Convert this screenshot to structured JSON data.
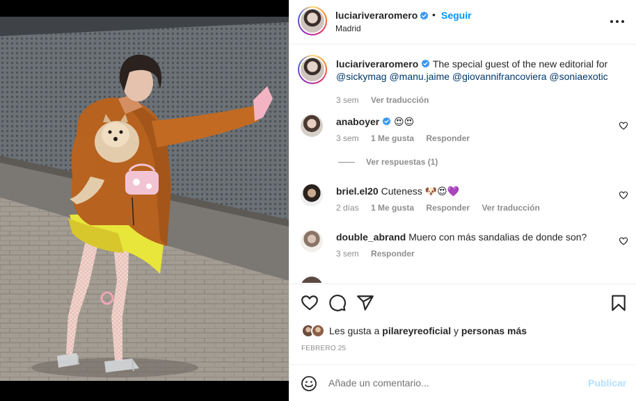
{
  "post": {
    "author": {
      "username": "luciariveraromero",
      "follow_label": "Seguir",
      "location": "Madrid",
      "more_icon": "more-horizontal-icon"
    },
    "caption": {
      "username": "luciariveraromero",
      "text": "The special guest of the new editorial for",
      "mentions": "@sickymag @manu.jaime @giovannifrancoviera @soniaexotic",
      "time": "3 sem",
      "translate_label": "Ver traducción"
    },
    "comments": [
      {
        "username": "anaboyer",
        "verified": true,
        "text": "😍😍",
        "time": "3 sem",
        "likes": "1 Me gusta",
        "reply_label": "Responder",
        "view_replies": "Ver respuestas (1)"
      },
      {
        "username": "briel.el20",
        "text": "Cuteness 🐶😍💜",
        "time": "2 días",
        "likes": "1 Me gusta",
        "reply_label": "Responder",
        "translate_label": "Ver traducción"
      },
      {
        "username": "double_abrand",
        "text": "Muero con más sandalias de donde son?",
        "time": "3 sem",
        "reply_label": "Responder"
      }
    ],
    "likes": {
      "prefix": "Les gusta a",
      "user": "pilareyreoficial",
      "middle": "y",
      "suffix": "personas más"
    },
    "date": "FEBRERO 25",
    "add_comment": {
      "placeholder": "Añade un comentario...",
      "publish_label": "Publicar"
    }
  },
  "colors": {
    "accent": "#0095f6",
    "publish_disabled": "#b2dffc",
    "secondary_text": "#8e8e8e",
    "mention_link": "#00376b",
    "verified": "#3897f0"
  }
}
